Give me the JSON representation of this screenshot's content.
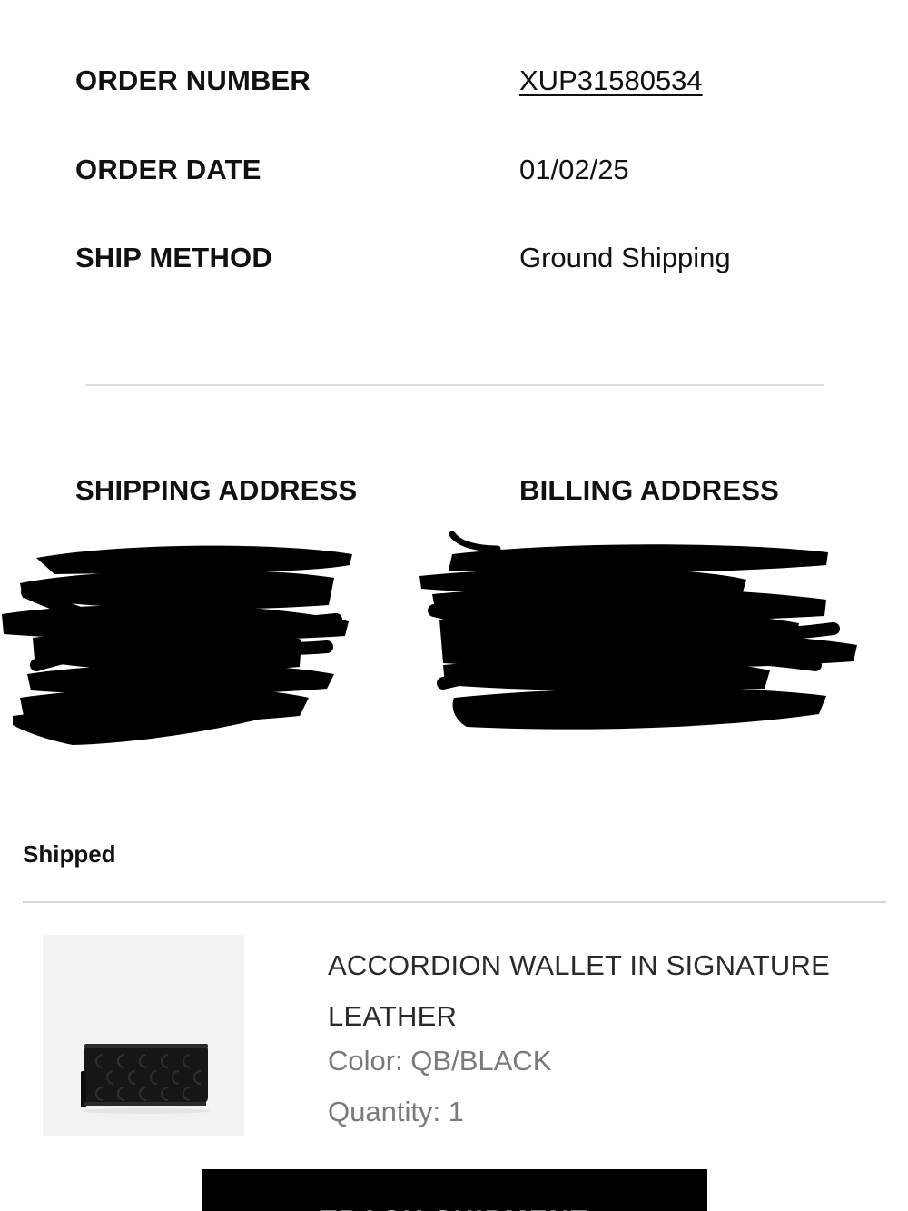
{
  "order": {
    "number_label": "ORDER NUMBER",
    "number_value": "XUP31580534",
    "date_label": "ORDER DATE",
    "date_value": "01/02/25",
    "ship_method_label": "SHIP METHOD",
    "ship_method_value": "Ground Shipping"
  },
  "addresses": {
    "shipping_heading": "SHIPPING ADDRESS",
    "billing_heading": "BILLING ADDRESS"
  },
  "shipment": {
    "status": "Shipped"
  },
  "product": {
    "name": "ACCORDION WALLET IN SIGNATURE LEATHER",
    "color": "Color: QB/BLACK",
    "quantity": "Quantity: 1"
  },
  "actions": {
    "track_label": "TRACK SHIPMENT"
  }
}
